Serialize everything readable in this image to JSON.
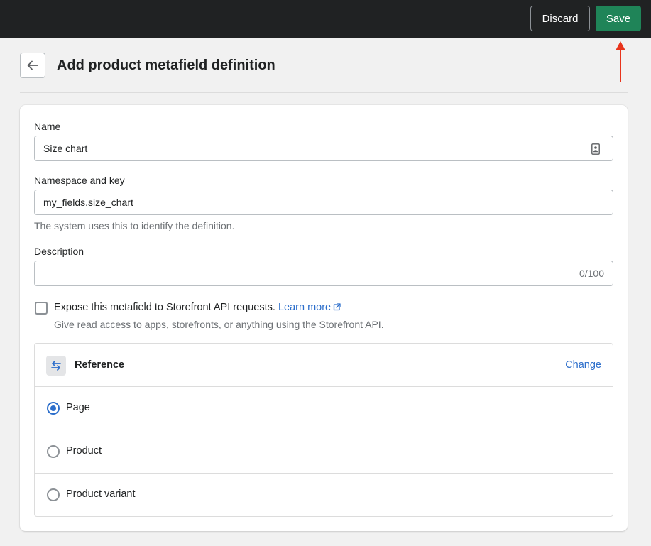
{
  "topbar": {
    "discard_label": "Discard",
    "save_label": "Save"
  },
  "header": {
    "title": "Add product metafield definition"
  },
  "form": {
    "name": {
      "label": "Name",
      "value": "Size chart"
    },
    "namespace_key": {
      "label": "Namespace and key",
      "value": "my_fields.size_chart",
      "help": "The system uses this to identify the definition."
    },
    "description": {
      "label": "Description",
      "value": "",
      "counter": "0/100"
    },
    "storefront": {
      "checked": false,
      "label": "Expose this metafield to Storefront API requests.",
      "link_label": "Learn more",
      "help": "Give read access to apps, storefronts, or anything using the Storefront API."
    }
  },
  "reference": {
    "title": "Reference",
    "change_label": "Change",
    "options": [
      {
        "label": "Page",
        "selected": true
      },
      {
        "label": "Product",
        "selected": false
      },
      {
        "label": "Product variant",
        "selected": false
      }
    ]
  },
  "colors": {
    "save": "#1f8458",
    "link": "#2c6ecb",
    "annotation_arrow": "#e8341c"
  }
}
